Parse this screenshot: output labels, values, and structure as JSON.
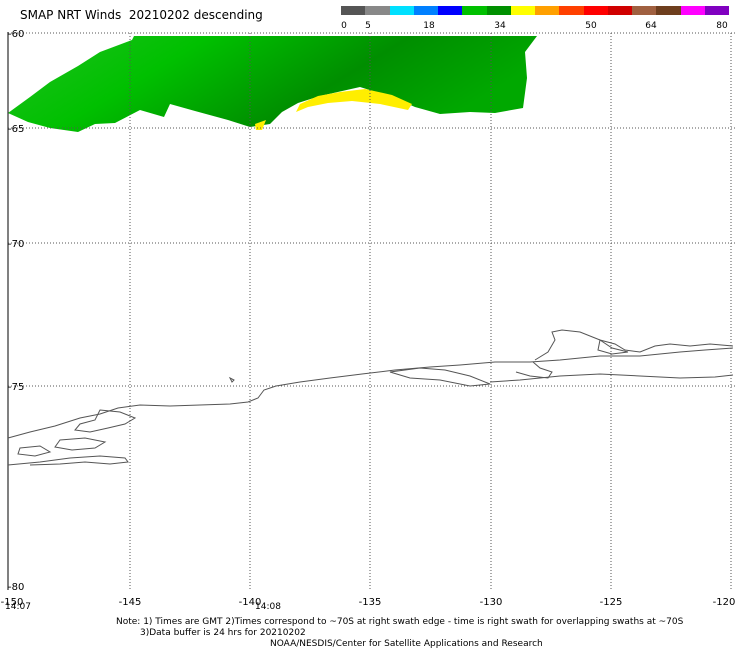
{
  "title": "SMAP NRT Winds  20210202 descending",
  "legend": {
    "ticks": [
      "0",
      "5",
      "18",
      "34",
      "50",
      "64",
      "80"
    ],
    "colors": [
      "#555555",
      "#888888",
      "#00e0ff",
      "#0080ff",
      "#0000ff",
      "#00c000",
      "#009000",
      "#ffff00",
      "#ffa000",
      "#ff4000",
      "#ff0000",
      "#d00000",
      "#a06040",
      "#6e3e1e",
      "#ff00ff",
      "#8000c0"
    ]
  },
  "map": {
    "lat_labels": [
      "-60",
      "-65",
      "-70",
      "-75",
      "-80"
    ],
    "lon_labels": [
      "-150",
      "-145",
      "-140",
      "-135",
      "-130",
      "-125",
      "-120"
    ],
    "time_labels": [
      "14:07",
      "14:08"
    ]
  },
  "footer": {
    "note1": "Note: 1) Times are GMT 2)Times correspond to ~70S at right swath edge - time is right swath for overlapping swaths at ~70S",
    "note2": "3)Data buffer is 24 hrs for 20210202",
    "credit": "NOAA/NESDIS/Center for Satellite Applications and Research"
  }
}
